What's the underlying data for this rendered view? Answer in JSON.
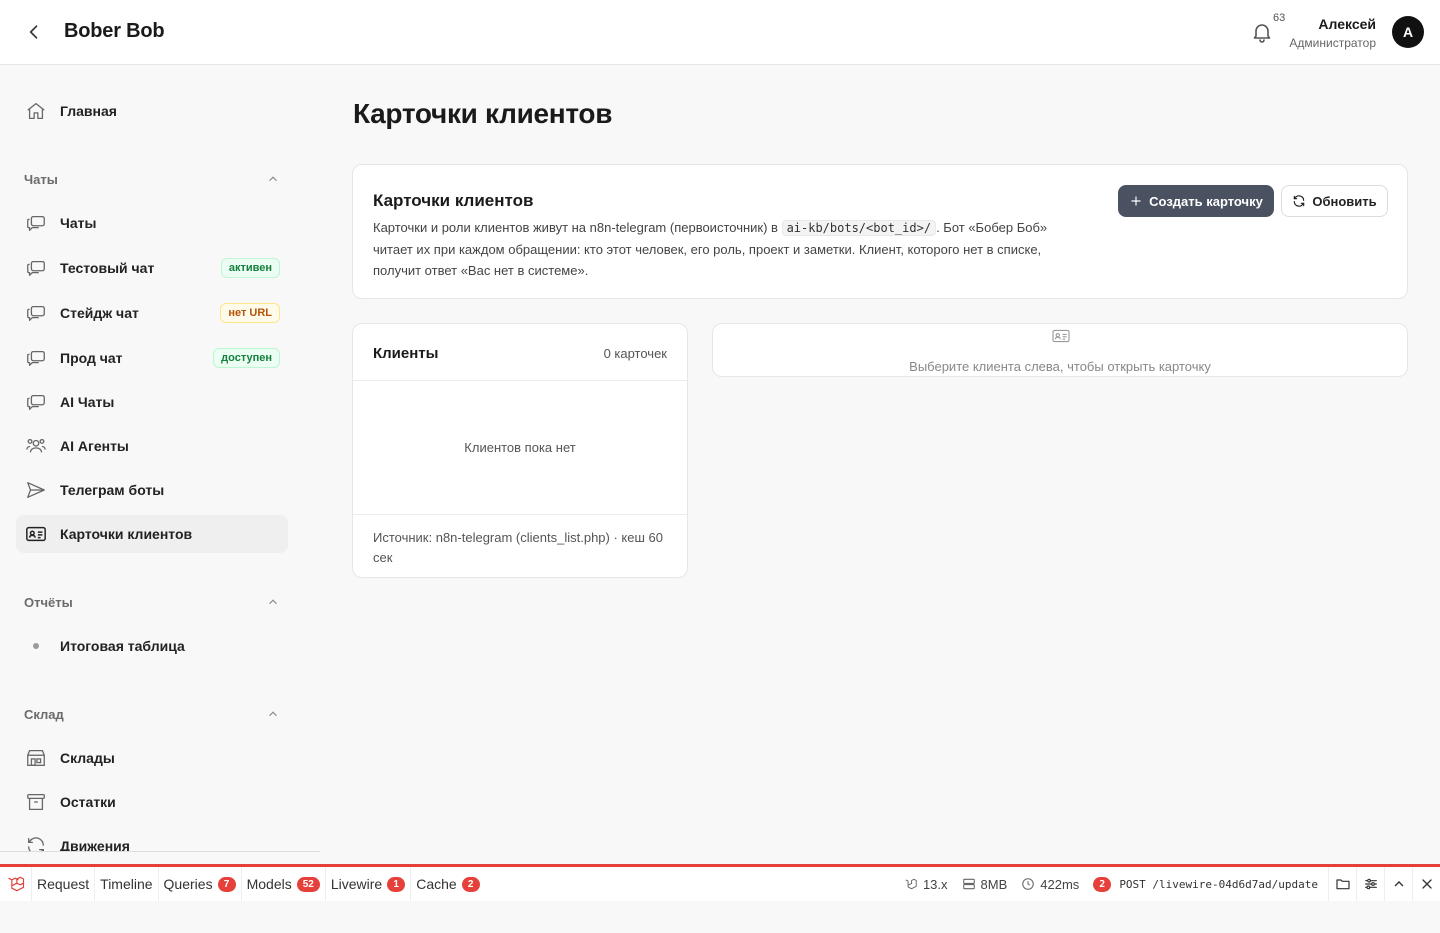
{
  "header": {
    "app_title": "Bober Bob",
    "notifications_count": "63",
    "user_name": "Алексей",
    "user_role": "Администратор",
    "avatar_letter": "А"
  },
  "sidebar": {
    "home": "Главная",
    "chats_section": "Чаты",
    "chats": [
      {
        "label": "Чаты",
        "icon": "chat-icon"
      },
      {
        "label": "Тестовый чат",
        "badge": "активен",
        "icon": "chat-icon"
      },
      {
        "label": "Стейдж чат",
        "badge": "нет URL",
        "icon": "chat-icon"
      },
      {
        "label": "Прод чат",
        "badge": "доступен",
        "icon": "chat-icon"
      },
      {
        "label": "AI Чаты",
        "icon": "chat-icon"
      },
      {
        "label": "AI Агенты",
        "icon": "users-icon"
      },
      {
        "label": "Телеграм боты",
        "icon": "paper-plane-icon"
      },
      {
        "label": "Карточки клиентов",
        "icon": "id-card-icon"
      }
    ],
    "reports_section": "Отчёты",
    "reports": [
      {
        "label": "Итоговая таблица"
      }
    ],
    "warehouse_section": "Склад",
    "warehouse": [
      {
        "label": "Склады",
        "icon": "warehouse-icon"
      },
      {
        "label": "Остатки",
        "icon": "archive-icon"
      },
      {
        "label": "Движения",
        "icon": "refresh-icon"
      }
    ]
  },
  "main": {
    "page_title": "Карточки клиентов",
    "info": {
      "title": "Карточки клиентов",
      "desc_1": "Карточки и роли клиентов живут на n8n-telegram (первоисточник) в ",
      "code": "ai-kb/bots/<bot_id>/",
      "desc_2": ". Бот «Бобер Боб» читает их при каждом обращении: кто этот человек, его роль, проект и заметки. Клиент, которого нет в списке, получит ответ «Вас нет в системе».",
      "create_button": "Создать карточку",
      "refresh_button": "Обновить"
    },
    "clients": {
      "title": "Клиенты",
      "count": "0 карточек",
      "empty": "Клиентов пока нет",
      "source": "Источник: n8n-telegram (clients_list.php) · кеш 60 сек"
    },
    "detail": {
      "hint": "Выберите клиента слева, чтобы открыть карточку"
    }
  },
  "debugbar": {
    "tabs": [
      {
        "label": "Request"
      },
      {
        "label": "Timeline"
      },
      {
        "label": "Queries",
        "count": "7"
      },
      {
        "label": "Models",
        "count": "52"
      },
      {
        "label": "Livewire",
        "count": "1"
      },
      {
        "label": "Cache",
        "count": "2"
      }
    ],
    "version": "13.x",
    "memory": "8MB",
    "time": "422ms",
    "requests_count": "2",
    "request": "POST /livewire-04d6d7ad/update"
  },
  "colors": {
    "accent": "#4a5160",
    "debugbar": "#e5403a",
    "badge_green": "#15803d",
    "badge_amber": "#b45309"
  }
}
